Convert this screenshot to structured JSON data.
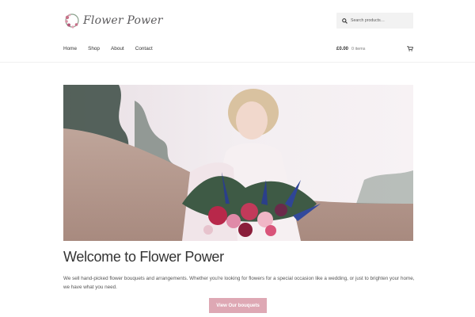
{
  "site": {
    "logo_text": "Flower Power"
  },
  "search": {
    "placeholder": "Search products…",
    "value": ""
  },
  "nav": {
    "items": [
      {
        "label": "Home"
      },
      {
        "label": "Shop"
      },
      {
        "label": "About"
      },
      {
        "label": "Contact"
      }
    ]
  },
  "cart": {
    "amount": "£0.00",
    "count": "0 items"
  },
  "colors": {
    "accent": "#dea8b4",
    "text": "#333333",
    "search_bg": "#f2f2f2"
  },
  "icons": {
    "search": "search-icon",
    "cart": "cart-icon",
    "logo": "flower-wreath-icon"
  },
  "main": {
    "title": "Welcome to Flower Power",
    "intro": "We sell hand-picked flower bouquets and arrangements. Whether you're looking for flowers for a special occasion like a wedding, or just to brighten your home, we have what you need.",
    "cta_label": "View Our bouquets"
  }
}
